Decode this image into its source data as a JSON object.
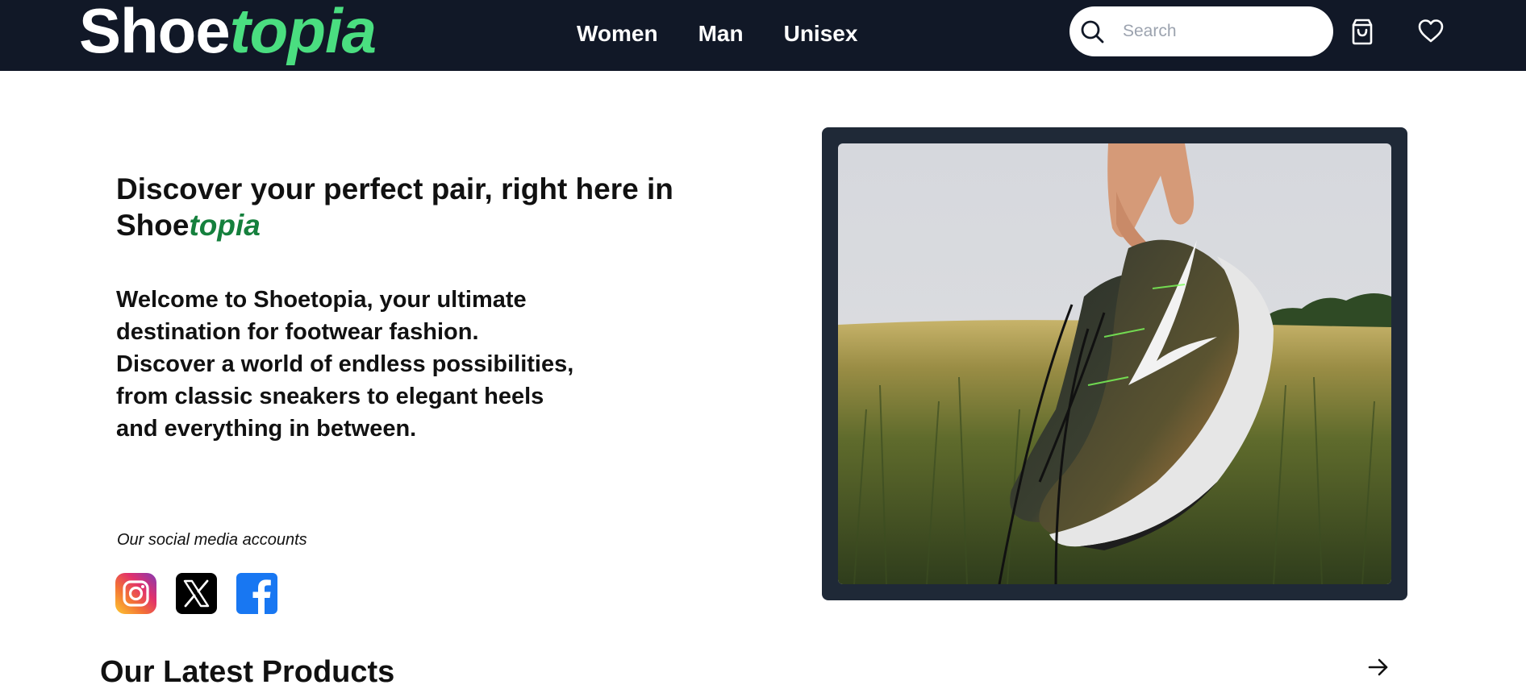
{
  "header": {
    "logo": {
      "part1": "Shoe",
      "part2": "topia"
    },
    "nav": [
      "Women",
      "Man",
      "Unisex"
    ],
    "search": {
      "placeholder": "Search",
      "value": ""
    },
    "icons": [
      "search-icon",
      "shopping-bag-icon",
      "heart-icon"
    ]
  },
  "hero": {
    "title_line1": "Discover your perfect pair, right here in",
    "title_brand_a": "Shoe",
    "title_brand_b": "topia",
    "description": "Welcome to Shoetopia, your ultimate destination for footwear fashion. Discover a world of endless possibilities, from classic sneakers to elegant heels and everything in between.",
    "social_label": "Our social media accounts",
    "social_icons": [
      "instagram-icon",
      "x-icon",
      "facebook-icon"
    ],
    "image_icon": "hand-holding-sneakers-photo"
  },
  "latest": {
    "title": "Our Latest Products",
    "arrow_icon": "arrow-right-icon"
  },
  "colors": {
    "header_bg": "#111827",
    "logo_accent": "#4ade80",
    "brand_green": "#15803d",
    "frame_bg": "#1f2937"
  }
}
